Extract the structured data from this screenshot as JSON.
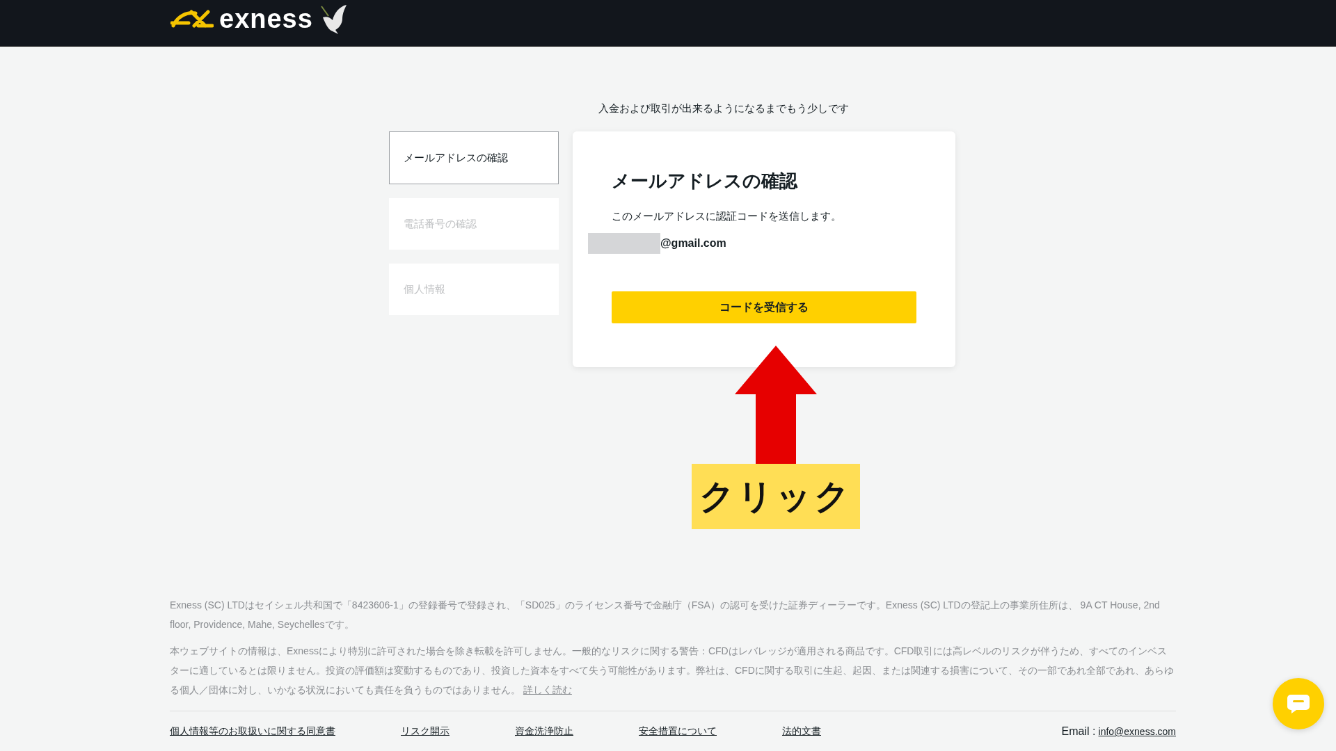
{
  "header": {
    "brand": "exness"
  },
  "subtitle": "入金および取引が出来るようになるまでもう少しです",
  "steps": [
    {
      "label": "メールアドレスの確認",
      "selected": true
    },
    {
      "label": "電話番号の確認",
      "selected": false
    },
    {
      "label": "個人情報",
      "selected": false
    }
  ],
  "card": {
    "title": "メールアドレスの確認",
    "description": "このメールアドレスに認証コードを送信します。",
    "email": "@gmail.com",
    "button": "コードを受信する"
  },
  "annotation": {
    "label": "クリック"
  },
  "footer": {
    "paragraphs": [
      {
        "text": "Exness (SC) LTDはセイシェル共和国で「8423606-1」の登録番号で登録され、「SD025」のライセンス番号で金融庁（FSA）の認可を受けた証券ディーラーです。Exness (SC) LTDの登記上の事業所住所は、 9A CT House, 2nd floor, Providence, Mahe, Seychellesです。"
      },
      {
        "text": "本ウェブサイトの情報は、Exnessにより特別に許可された場合を除き転載を許可しません。一般的なリスクに関する警告：CFDはレバレッジが適用される商品です。CFD取引には高レベルのリスクが伴うため、すべてのインベスターに適しているとは限りません。投資の評価額は変動するものであり、投資した資本をすべて失う可能性があります。弊社は、CFDに関する取引に生起、起因、または関連する損害について、その一部であれ全部であれ、あらゆる個人／団体に対し、いかなる状況においても責任を負うものではありません。",
        "link": "詳しく読む"
      }
    ],
    "links": [
      "個人情報等のお取扱いに関する同意書",
      "リスク開示",
      "資金洗浄防止",
      "安全措置について",
      "法的文書"
    ],
    "email_label": "Email :",
    "email": "info@exness.com"
  }
}
